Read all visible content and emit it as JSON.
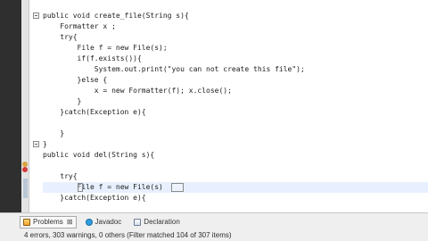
{
  "editor": {
    "lines": [
      {
        "text": "public void create_file(String s){"
      },
      {
        "text": "    Formatter x ;"
      },
      {
        "text": "    try{"
      },
      {
        "text": "        File f = new File(s);"
      },
      {
        "text": "        if(f.exists()){"
      },
      {
        "text": "            System.out.print(\"you can not create this file\");"
      },
      {
        "text": "        }else {"
      },
      {
        "text": "            x = new Formatter(f); x.close();"
      },
      {
        "text": "        }"
      },
      {
        "text": "    }catch(Exception e){"
      },
      {
        "text": ""
      },
      {
        "text": "    }"
      },
      {
        "text": "}"
      },
      {
        "text": "public void del(String s){"
      },
      {
        "text": ""
      },
      {
        "text": "    try{"
      },
      {
        "text": "        File f = new File(s)"
      },
      {
        "text": "    }catch(Exception e){"
      }
    ]
  },
  "bottom_panel": {
    "tabs": [
      {
        "label": "Problems",
        "icon": "problems-icon",
        "close": "⊠",
        "active": true
      },
      {
        "label": "Javadoc",
        "icon": "javadoc-icon",
        "active": false
      },
      {
        "label": "Declaration",
        "icon": "declaration-icon",
        "active": false
      }
    ],
    "summary": "4 errors, 303 warnings, 0 others (Filter matched 104 of 307 items)"
  },
  "colors": {
    "editor_background": "#ffffff",
    "current_line": "#e8f0ff",
    "left_gutter": "#2f2f2f",
    "panel_background": "#efefef"
  }
}
